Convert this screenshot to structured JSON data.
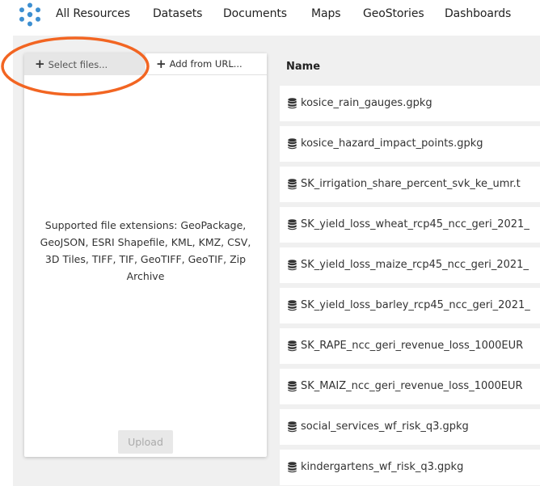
{
  "nav": {
    "items": [
      {
        "label": "All Resources"
      },
      {
        "label": "Datasets"
      },
      {
        "label": "Documents"
      },
      {
        "label": "Maps"
      },
      {
        "label": "GeoStories"
      },
      {
        "label": "Dashboards"
      }
    ]
  },
  "upload": {
    "select_files_label": "Select files...",
    "add_from_url_label": "Add from URL...",
    "supported_extensions_text": "Supported file extensions: GeoPackage, GeoJSON, ESRI Shapefile, KML, KMZ, CSV, 3D Tiles, TIFF, TIF, GeoTIFF, GeoTIF, Zip Archive",
    "upload_button_label": "Upload"
  },
  "resources": {
    "header": "Name",
    "rows": [
      {
        "name": "kosice_rain_gauges.gpkg"
      },
      {
        "name": "kosice_hazard_impact_points.gpkg"
      },
      {
        "name": "SK_irrigation_share_percent_svk_ke_umr.t"
      },
      {
        "name": "SK_yield_loss_wheat_rcp45_ncc_geri_2021_"
      },
      {
        "name": "SK_yield_loss_maize_rcp45_ncc_geri_2021_"
      },
      {
        "name": "SK_yield_loss_barley_rcp45_ncc_geri_2021_"
      },
      {
        "name": "SK_RAPE_ncc_geri_revenue_loss_1000EUR"
      },
      {
        "name": "SK_MAIZ_ncc_geri_revenue_loss_1000EUR"
      },
      {
        "name": "social_services_wf_risk_q3.gpkg"
      },
      {
        "name": "kindergartens_wf_risk_q3.gpkg"
      }
    ],
    "row_icon": "database-icon"
  },
  "colors": {
    "brand_blue": "#3d8fd1",
    "highlight_orange": "#f26522",
    "content_background": "#f0f0f0"
  }
}
